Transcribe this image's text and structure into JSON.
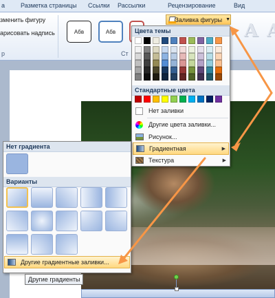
{
  "ribbon": {
    "tabs": [
      "а",
      "Разметка страницы",
      "Ссылки",
      "Рассылки",
      "Рецензирование",
      "Вид"
    ],
    "left_items": [
      "зменить фигуру",
      "арисовать надпись"
    ],
    "left_group_label": "р",
    "style_thumbs": [
      "Абв",
      "Абв",
      ""
    ],
    "styles_group_label": "Ст",
    "fill_button_label": "Заливка фигуры",
    "wordart_letter": "A"
  },
  "color_menu": {
    "theme_colors_header": "Цвета темы",
    "standard_colors_header": "Стандартные цвета",
    "theme_columns": [
      [
        "#ffffff",
        "#f2f2f2",
        "#d9d9d9",
        "#bfbfbf",
        "#a6a6a6",
        "#808080"
      ],
      [
        "#000000",
        "#808080",
        "#595959",
        "#404040",
        "#262626",
        "#0d0d0d"
      ],
      [
        "#eeece1",
        "#ddd9c3",
        "#c4bd97",
        "#948a54",
        "#4a452a",
        "#1e1c11"
      ],
      [
        "#1f497d",
        "#c6d9f1",
        "#8db3e2",
        "#548dd4",
        "#17365d",
        "#0f243e"
      ],
      [
        "#4f81bd",
        "#dbe5f1",
        "#b8cce4",
        "#95b3d7",
        "#366092",
        "#244061"
      ],
      [
        "#c0504d",
        "#f2dcdb",
        "#e6b9b8",
        "#d99694",
        "#953735",
        "#632523"
      ],
      [
        "#9bbb59",
        "#ebf1de",
        "#d7e4bd",
        "#c3d69b",
        "#76923c",
        "#4f6228"
      ],
      [
        "#8064a2",
        "#e5e0ec",
        "#ccc1da",
        "#b3a2c7",
        "#5f497a",
        "#3f3151"
      ],
      [
        "#4bacc6",
        "#dbeef4",
        "#b7dee8",
        "#93cddd",
        "#31859c",
        "#205867"
      ],
      [
        "#f79646",
        "#fdeada",
        "#fbd5b5",
        "#fac090",
        "#e46c0a",
        "#984807"
      ]
    ],
    "standard_colors": [
      "#c00000",
      "#ff0000",
      "#ffc000",
      "#ffff00",
      "#92d050",
      "#00b050",
      "#00b0f0",
      "#0070c0",
      "#002060",
      "#7030a0"
    ],
    "items": {
      "no_fill": "Нет заливки",
      "more_colors": "Другие цвета заливки...",
      "picture": "Рисунок...",
      "gradient": "Градиентная",
      "texture": "Текстура"
    }
  },
  "gradient_panel": {
    "no_gradient_header": "Нет градиента",
    "variants_header": "Варианты",
    "more_gradients": "Другие градиентные заливки..."
  },
  "tooltip": "Другие градиенты",
  "colors": {
    "highlight": "#ffd880",
    "arrow": "#f79646",
    "menu_header_bg": "#dde5ef"
  }
}
